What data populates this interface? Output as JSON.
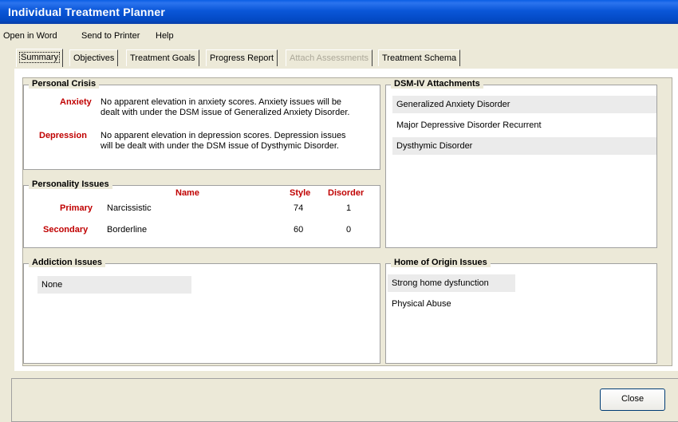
{
  "window": {
    "title": "Individual Treatment Planner"
  },
  "menu": [
    "Open in Word",
    "Send to Printer",
    "Help"
  ],
  "tabs": [
    {
      "label": "Summary",
      "state": "active"
    },
    {
      "label": "Objectives",
      "state": "normal"
    },
    {
      "label": "Treatment Goals",
      "state": "normal"
    },
    {
      "label": "Progress Report",
      "state": "normal"
    },
    {
      "label": "Attach Assessments",
      "state": "disabled"
    },
    {
      "label": "Treatment Schema",
      "state": "normal"
    }
  ],
  "personal_crisis": {
    "title": "Personal Crisis",
    "items": [
      {
        "label": "Anxiety",
        "text_line1": "No apparent elevation in anxiety scores. Anxiety issues will be",
        "text_line2": "dealt with under the DSM issue of Generalized Anxiety Disorder."
      },
      {
        "label": "Depression",
        "text_line1": "No apparent elevation in depression scores. Depression issues",
        "text_line2": "will be dealt with under the DSM issue of Dysthymic Disorder."
      }
    ]
  },
  "personality": {
    "title": "Personality Issues",
    "headers": {
      "name": "Name",
      "style": "Style",
      "disorder": "Disorder"
    },
    "rows": [
      {
        "label": "Primary",
        "name": "Narcissistic",
        "style": "74",
        "disorder": "1"
      },
      {
        "label": "Secondary",
        "name": "Borderline",
        "style": "60",
        "disorder": "0"
      }
    ]
  },
  "addiction": {
    "title": "Addiction Issues",
    "items": [
      "None"
    ]
  },
  "dsm": {
    "title": "DSM-IV Attachments",
    "items": [
      "Generalized Anxiety Disorder",
      "Major Depressive Disorder Recurrent",
      "Dysthymic Disorder"
    ]
  },
  "home": {
    "title": "Home of Origin Issues",
    "items": [
      "Strong home dysfunction",
      "Physical Abuse"
    ]
  },
  "footer": {
    "close_label": "Close"
  },
  "colors": {
    "title_bar": "#0a56d8",
    "label_red": "#c00000",
    "row_shade": "#ebebeb"
  }
}
